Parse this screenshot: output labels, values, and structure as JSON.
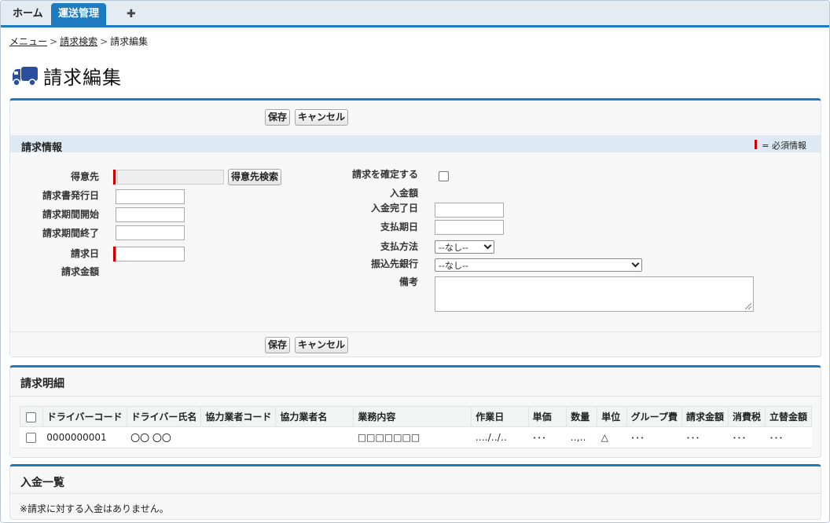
{
  "tabs": {
    "home": "ホーム",
    "active": "運送管理",
    "add": "✚"
  },
  "breadcrumb": {
    "menu": "メニュー",
    "search": "請求検索",
    "current": "請求編集",
    "sep": ">"
  },
  "page": {
    "title": "請求編集",
    "icon": "truck-icon"
  },
  "buttons": {
    "save": "保存",
    "cancel": "キャンセル",
    "customer_search": "得意先検索"
  },
  "section": {
    "title": "請求情報",
    "required_legend": "= 必須情報"
  },
  "form_left": {
    "customer": "得意先",
    "issue_date": "請求書発行日",
    "period_start": "請求期間開始",
    "period_end": "請求期間終了",
    "billing_date": "請求日",
    "billing_amount": "請求金額"
  },
  "form_right": {
    "confirm": "請求を確定する",
    "received_amount": "入金額",
    "payment_complete_date": "入金完了日",
    "due_date": "支払期日",
    "payment_method": "支払方法",
    "bank": "振込先銀行",
    "remarks": "備考",
    "payment_method_value": "--なし--",
    "bank_value": "--なし--"
  },
  "detail": {
    "title": "請求明細",
    "columns": [
      "ドライバーコード",
      "ドライバー氏名",
      "協力業者コード",
      "協力業者名",
      "業務内容",
      "作業日",
      "単価",
      "数量",
      "単位",
      "グループ費",
      "請求金額",
      "消費税",
      "立替金額"
    ],
    "rows": [
      [
        "0000000001",
        "〇〇 〇〇",
        "",
        "",
        "□□□□□□□",
        "‥‥/‥/‥",
        "･･･",
        "‥,‥",
        "△",
        "･･･",
        "･･･",
        "･･･",
        "･･･"
      ]
    ]
  },
  "payments": {
    "title": "入金一覧",
    "empty": "※請求に対する入金はありません。"
  },
  "colors": {
    "accent": "#1e7bc2",
    "required": "#cc0000"
  }
}
